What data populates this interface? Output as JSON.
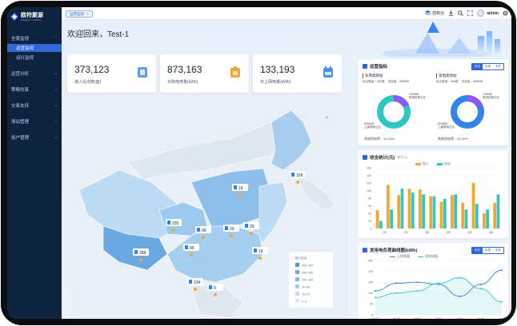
{
  "app": {
    "title": "欧符聚源",
    "subtitle": "ENERGY POWER"
  },
  "sidebar": {
    "items": [
      {
        "label": "全景监视",
        "expanded": true,
        "children": [
          {
            "label": "运营监视",
            "active": true
          },
          {
            "label": "运行监视",
            "active": false
          }
        ]
      },
      {
        "label": "运营分析",
        "expanded": false
      },
      {
        "label": "策略仿真",
        "expanded": false
      },
      {
        "label": "交易支持",
        "expanded": false
      },
      {
        "label": "场站管理",
        "expanded": false
      },
      {
        "label": "用户管理",
        "expanded": false
      }
    ]
  },
  "topbar": {
    "tab_label": "运营监视",
    "tab_close": "×",
    "control_label": "控制台",
    "username": "admin"
  },
  "welcome": "欢迎回来，Test-1",
  "stats": [
    {
      "value": "373,123",
      "label": "接入站点数(座)",
      "color": "#3b82f6"
    },
    {
      "value": "873,163",
      "label": "日购电电量(kWh)",
      "color": "#f6a33b"
    },
    {
      "value": "133,193",
      "label": "日上网电量(kWh)",
      "color": "#3b82f6"
    }
  ],
  "map": {
    "markers": [
      {
        "value": "199"
      },
      {
        "value": "19"
      },
      {
        "value": "235"
      },
      {
        "value": "99"
      },
      {
        "value": "29"
      },
      {
        "value": "29"
      },
      {
        "value": "99"
      },
      {
        "value": "19"
      },
      {
        "value": "399"
      },
      {
        "value": "134"
      },
      {
        "value": "9"
      }
    ],
    "legend_title": "接入站点",
    "legend": [
      {
        "label": "300~499",
        "color": "#4f93d9"
      },
      {
        "label": "200~299",
        "color": "#6aa9e2"
      },
      {
        "label": "100~199",
        "color": "#86bbe9"
      },
      {
        "label": "30~99",
        "color": "#a2cdef"
      },
      {
        "label": "10~29",
        "color": "#bedcf4"
      },
      {
        "label": "1~9",
        "color": "#daeaf9"
      }
    ]
  },
  "ops": {
    "title": "运营指标",
    "tabs": [
      "本日",
      "本周",
      "本年"
    ],
    "active_tab": 0,
    "left": {
      "name": "负荷类场站",
      "site_label": "站点数量：285座",
      "cap_label": "总容量：285MW",
      "pct_a": "100MW",
      "pct_a_sub": "系统负荷占比",
      "pct_b": "820MW",
      "pct_b_sub": "上级电网占比",
      "footer": "系统用电率：12.20%",
      "fraction": 0.18
    },
    "right": {
      "name": "发电类场站",
      "site_label": "站点数量：285座",
      "cap_label": "总容量：285MW",
      "pct_a": "100MW",
      "pct_a_sub": "系统负荷占比",
      "pct_b": "820MW",
      "pct_b_sub": "上级电网占比",
      "footer": "系统用电率：12.20%",
      "fraction": 0.18
    }
  },
  "income": {
    "title": "收支统计(元)",
    "unit": "单位:元",
    "legend": [
      {
        "name": "收入",
        "color": "#f5a531"
      },
      {
        "name": "支出",
        "color": "#2fc8c0"
      }
    ]
  },
  "load": {
    "title": "发用电负荷曲线图(kWh)",
    "tabs": [
      "本日",
      "本周",
      "本年"
    ],
    "active_tab": 0,
    "legend": [
      {
        "name": "上网电量",
        "color": "#2f86e8"
      },
      {
        "name": "用电电量",
        "color": "#2fc8c0"
      }
    ]
  },
  "chart_data": [
    {
      "type": "bar",
      "title": "收支统计(元)",
      "categories": [
        "1月",
        "2月",
        "3月",
        "4月",
        "5月",
        "6月"
      ],
      "ylim": [
        0,
        160
      ],
      "yticks": [
        0,
        20,
        40,
        60,
        80,
        100,
        120,
        140,
        160
      ],
      "series": [
        {
          "name": "收入",
          "values": [
            48,
            115,
            88,
            105,
            103,
            85,
            70,
            88,
            68,
            120,
            40,
            68
          ]
        },
        {
          "name": "支出",
          "values": [
            20,
            50,
            105,
            95,
            90,
            85,
            78,
            90,
            50,
            65,
            50,
            90
          ]
        }
      ]
    },
    {
      "type": "line",
      "title": "发用电负荷曲线图(kWh)",
      "categories": [
        "00:00",
        "04:00",
        "08:00",
        "12:00",
        "16:00",
        "20:00",
        "24:00"
      ],
      "ylim": [
        0,
        250
      ],
      "yticks": [
        0,
        50,
        100,
        150,
        200,
        250
      ],
      "series": [
        {
          "name": "上网电量",
          "values": [
            110,
            145,
            150,
            140,
            85,
            140,
            205
          ]
        },
        {
          "name": "用电电量",
          "values": [
            80,
            100,
            110,
            145,
            170,
            120,
            60
          ]
        }
      ]
    }
  ]
}
